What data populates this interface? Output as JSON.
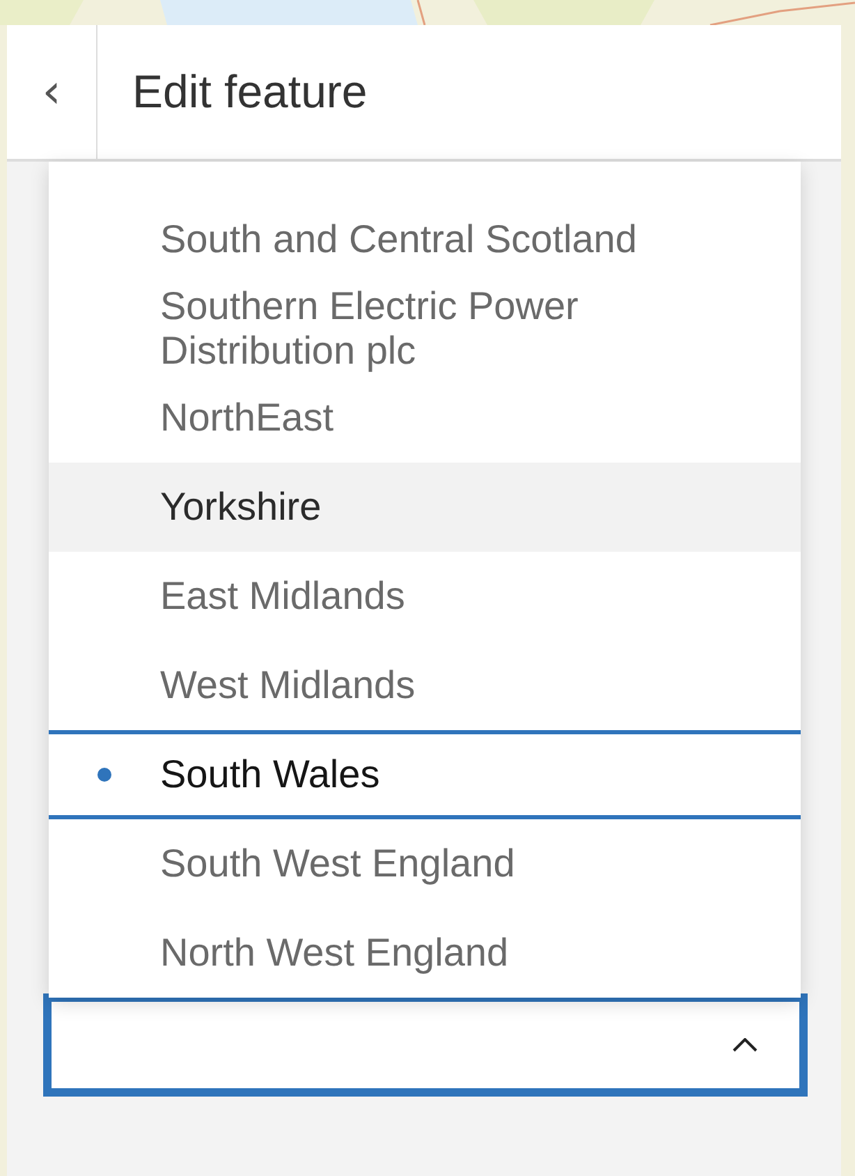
{
  "header": {
    "back_icon": "‹",
    "title": "Edit feature"
  },
  "dropdown": {
    "expanded": true,
    "options": [
      {
        "label": "South and Central Scotland",
        "selected": false,
        "highlighted": false
      },
      {
        "label": "Southern Electric Power Distribution plc",
        "selected": false,
        "highlighted": false
      },
      {
        "label": "NorthEast",
        "selected": false,
        "highlighted": false
      },
      {
        "label": "Yorkshire",
        "selected": false,
        "highlighted": true
      },
      {
        "label": "East Midlands",
        "selected": false,
        "highlighted": false
      },
      {
        "label": "West Midlands",
        "selected": false,
        "highlighted": false
      },
      {
        "label": "South Wales",
        "selected": true,
        "highlighted": false
      },
      {
        "label": "South West England",
        "selected": false,
        "highlighted": false
      },
      {
        "label": "North West England",
        "selected": false,
        "highlighted": false
      }
    ]
  }
}
